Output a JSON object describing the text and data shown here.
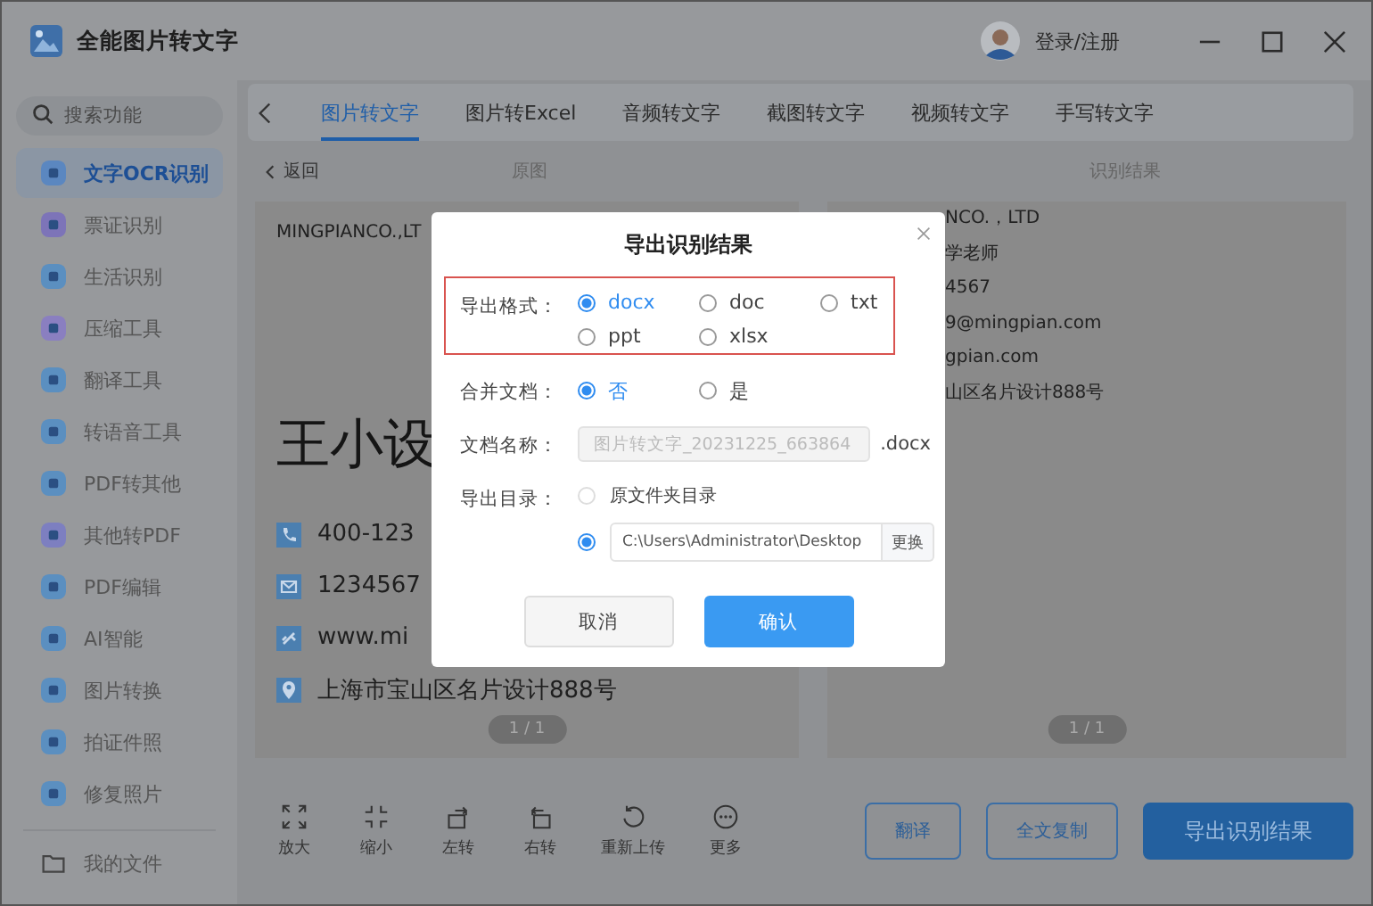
{
  "window": {
    "title": "全能图片转文字",
    "login": "登录/注册"
  },
  "sidebar": {
    "search": {
      "placeholder": "搜索功能"
    },
    "items": [
      {
        "label": "文字OCR识别",
        "selected": true,
        "color": "#5b87c0"
      },
      {
        "label": "票证识别",
        "selected": false,
        "color": "#7d74b8"
      },
      {
        "label": "生活识别",
        "selected": false,
        "color": "#5b8fc0"
      },
      {
        "label": "压缩工具",
        "selected": false,
        "color": "#8a7fc0"
      },
      {
        "label": "翻译工具",
        "selected": false,
        "color": "#5b8fc0"
      },
      {
        "label": "转语音工具",
        "selected": false,
        "color": "#5b8fc0"
      },
      {
        "label": "PDF转其他",
        "selected": false,
        "color": "#5b8fc0"
      },
      {
        "label": "其他转PDF",
        "selected": false,
        "color": "#7d7fc0"
      },
      {
        "label": "PDF编辑",
        "selected": false,
        "color": "#5b8fc0"
      },
      {
        "label": "AI智能",
        "selected": false,
        "color": "#5b8fc0"
      },
      {
        "label": "图片转换",
        "selected": false,
        "color": "#5b8fc0"
      },
      {
        "label": "拍证件照",
        "selected": false,
        "color": "#5b8fc0"
      },
      {
        "label": "修复照片",
        "selected": false,
        "color": "#5b8fc0"
      }
    ],
    "footer": "我的文件"
  },
  "tabs": [
    {
      "label": "图片转文字",
      "selected": true
    },
    {
      "label": "图片转Excel",
      "selected": false
    },
    {
      "label": "音频转文字",
      "selected": false
    },
    {
      "label": "截图转文字",
      "selected": false
    },
    {
      "label": "视频转文字",
      "selected": false
    },
    {
      "label": "手写转文字",
      "selected": false
    }
  ],
  "subheader": {
    "back": "返回",
    "left_title": "原图",
    "right_title": "识别结果"
  },
  "original": {
    "company": "MINGPIANCO.,LT",
    "name": "王小设",
    "contacts": [
      {
        "kind": "phone",
        "text": "400-123"
      },
      {
        "kind": "mail",
        "text": "1234567"
      },
      {
        "kind": "link",
        "text": "www.mi"
      },
      {
        "kind": "pin",
        "text": "上海市宝山区名片设计888号"
      }
    ],
    "page": "1 / 1"
  },
  "result": {
    "lines": [
      "NCO.，LTD",
      "学老师",
      "4567",
      "9@mingpian.com",
      "gpian.com",
      "山区名片设计888号"
    ],
    "page": "1 / 1"
  },
  "toolbar": [
    {
      "kind": "expand",
      "label": "放大"
    },
    {
      "kind": "shrink",
      "label": "缩小"
    },
    {
      "kind": "rotate_left",
      "label": "左转"
    },
    {
      "kind": "rotate_right",
      "label": "右转"
    },
    {
      "kind": "reupload",
      "label": "重新上传"
    },
    {
      "kind": "more",
      "label": "更多"
    }
  ],
  "actions": [
    {
      "label": "翻译",
      "primary": false
    },
    {
      "label": "全文复制",
      "primary": false
    },
    {
      "label": "导出识别结果",
      "primary": true
    }
  ],
  "dialog": {
    "title": "导出识别结果",
    "format": {
      "label": "导出格式：",
      "options": [
        {
          "label": "docx",
          "selected": true
        },
        {
          "label": "doc",
          "selected": false
        },
        {
          "label": "txt",
          "selected": false
        },
        {
          "label": "ppt",
          "selected": false
        },
        {
          "label": "xlsx",
          "selected": false
        }
      ]
    },
    "merge": {
      "label": "合并文档：",
      "options": [
        {
          "label": "否",
          "selected": true
        },
        {
          "label": "是",
          "selected": false
        }
      ]
    },
    "name": {
      "label": "文档名称：",
      "value": "图片转文字_20231225_663864",
      "disabled": true,
      "suffix": ".docx"
    },
    "directory": {
      "label": "导出目录：",
      "options": [
        {
          "kind": "source",
          "label": "原文件夹目录",
          "selected": false
        },
        {
          "kind": "path",
          "value": "C:\\Users\\Administrator\\Desktop",
          "button": "更换",
          "selected": true
        }
      ]
    },
    "cancel": "取消",
    "confirm": "确认"
  }
}
